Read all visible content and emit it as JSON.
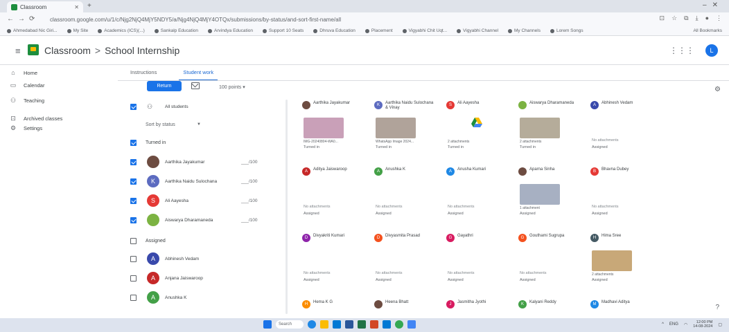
{
  "browser": {
    "tab_title": "Classroom",
    "url": "classroom.google.com/u/1/c/Njg2NjQ4MjY5NDY5/a/Njg4NjQ4MjY4OTQx/submissions/by-status/and-sort-first-name/all",
    "bookmarks": [
      "Ahmedabad Nic Giri...",
      "My Site",
      "Academics (ICS)(...)",
      "Sankalp Education",
      "Arvindya Education",
      "Support 10 Seats",
      "Dhruva Education",
      "Placement",
      "Vigyabhi Chit Uqt...",
      "Vigyabhi Channel",
      "My Channels",
      "Lorem Songs"
    ],
    "bookmarks_right": "All Bookmarks"
  },
  "header": {
    "app": "Classroom",
    "separator": ">",
    "course": "School Internship",
    "avatar_letter": "L"
  },
  "sidebar": {
    "items": [
      {
        "label": "Home",
        "icon": "home-icon"
      },
      {
        "label": "Calendar",
        "icon": "calendar-icon"
      },
      {
        "label": "Teaching",
        "icon": "people-icon"
      },
      {
        "label": "Archived classes",
        "icon": "archive-icon"
      },
      {
        "label": "Settings",
        "icon": "gear-icon"
      }
    ]
  },
  "tabs": {
    "instructions": "Instructions",
    "student_work": "Student work"
  },
  "toolbar": {
    "return_label": "Return",
    "points": "100 points"
  },
  "list": {
    "all_students": "All students",
    "sort": "Sort by status",
    "turned_in": "Turned in",
    "assigned": "Assigned",
    "turned_in_students": [
      {
        "name": "Aarthika Jayakumar",
        "grade": "___/100",
        "letter": "",
        "color": "#6d4c41"
      },
      {
        "name": "Aarthika Naidu Sulochana",
        "grade": "___/100",
        "letter": "K",
        "color": "#5c6bc0"
      },
      {
        "name": "Ali Aayesha",
        "grade": "___/100",
        "letter": "S",
        "color": "#e53935"
      },
      {
        "name": "Aiswarya Dharamaneda",
        "grade": "___/100",
        "letter": "",
        "color": "#7cb342"
      }
    ],
    "assigned_students": [
      {
        "name": "Abhinesh Vedam",
        "letter": "A",
        "color": "#3949ab"
      },
      {
        "name": "Anjana Jaiswaroop",
        "letter": "A",
        "color": "#c62828"
      },
      {
        "name": "Anushka K",
        "letter": "A",
        "color": "#43a047"
      }
    ]
  },
  "cards": [
    {
      "name": "Aarthika Jayakumar",
      "letter": "",
      "color": "#6d4c41",
      "file": "IMG-20240804-WA0...",
      "status": "Turned in",
      "thumb": "#c9a0b8"
    },
    {
      "name": "Aarthika Naidu Sulochana & Vinay",
      "letter": "K",
      "color": "#5c6bc0",
      "file": "WhatsApp Image 2024...",
      "status": "Turned in",
      "thumb": "#b0a39a"
    },
    {
      "name": "Ali Aayesha",
      "letter": "S",
      "color": "#e53935",
      "file": "2 attachments",
      "status": "Turned in",
      "thumb": ""
    },
    {
      "name": "Aiswarya Dharamaneda",
      "letter": "",
      "color": "#7cb342",
      "file": "2 attachments",
      "status": "Turned in",
      "thumb": "#b5ac9a"
    },
    {
      "name": "Abhinesh Vedam",
      "letter": "A",
      "color": "#3949ab",
      "none": "No attachments",
      "status": "Assigned"
    },
    {
      "name": "Aditya Jaiswaroop",
      "letter": "A",
      "color": "#c62828",
      "none": "No attachments",
      "status": "Assigned"
    },
    {
      "name": "Anushka K",
      "letter": "A",
      "color": "#43a047",
      "none": "No attachments",
      "status": "Assigned"
    },
    {
      "name": "Anusha Kumari",
      "letter": "A",
      "color": "#1e88e5",
      "none": "No attachments",
      "status": "Assigned"
    },
    {
      "name": "Aparna Sinha",
      "letter": "",
      "color": "#6d4c41",
      "file": "1 attachment",
      "status": "Assigned",
      "thumb": "#a7b0c2"
    },
    {
      "name": "Bhavna Dubey",
      "letter": "B",
      "color": "#e53935",
      "none": "No attachments",
      "status": "Assigned"
    },
    {
      "name": "Divyakriti Kumari",
      "letter": "D",
      "color": "#8e24aa",
      "none": "No attachments",
      "status": "Assigned"
    },
    {
      "name": "Divyasmita Prasad",
      "letter": "D",
      "color": "#f4511e",
      "none": "No attachments",
      "status": "Assigned"
    },
    {
      "name": "Gayathri",
      "letter": "G",
      "color": "#d81b60",
      "none": "No attachments",
      "status": "Assigned"
    },
    {
      "name": "Gouthami Sugrupa",
      "letter": "G",
      "color": "#f4511e",
      "none": "No attachments",
      "status": "Assigned"
    },
    {
      "name": "Hima Sree",
      "letter": "H",
      "color": "#455a64",
      "file": "2 attachments",
      "status": "Assigned",
      "thumb": "#c8a878"
    },
    {
      "name": "Hema K G",
      "letter": "H",
      "color": "#fb8c00",
      "none": "",
      "status": ""
    },
    {
      "name": "Heena Bhatt",
      "letter": "",
      "color": "#6d4c41",
      "none": "",
      "status": ""
    },
    {
      "name": "Jasmitha Jyothi",
      "letter": "J",
      "color": "#d81b60",
      "none": "",
      "status": ""
    },
    {
      "name": "Kalyani Reddy",
      "letter": "K",
      "color": "#43a047",
      "none": "",
      "status": ""
    },
    {
      "name": "Madhavi Aditya",
      "letter": "M",
      "color": "#1e88e5",
      "none": "",
      "status": ""
    }
  ],
  "taskbar": {
    "search": "Search",
    "time": "12:00 PM",
    "date": "14-08-2024",
    "lang": "ENG"
  }
}
